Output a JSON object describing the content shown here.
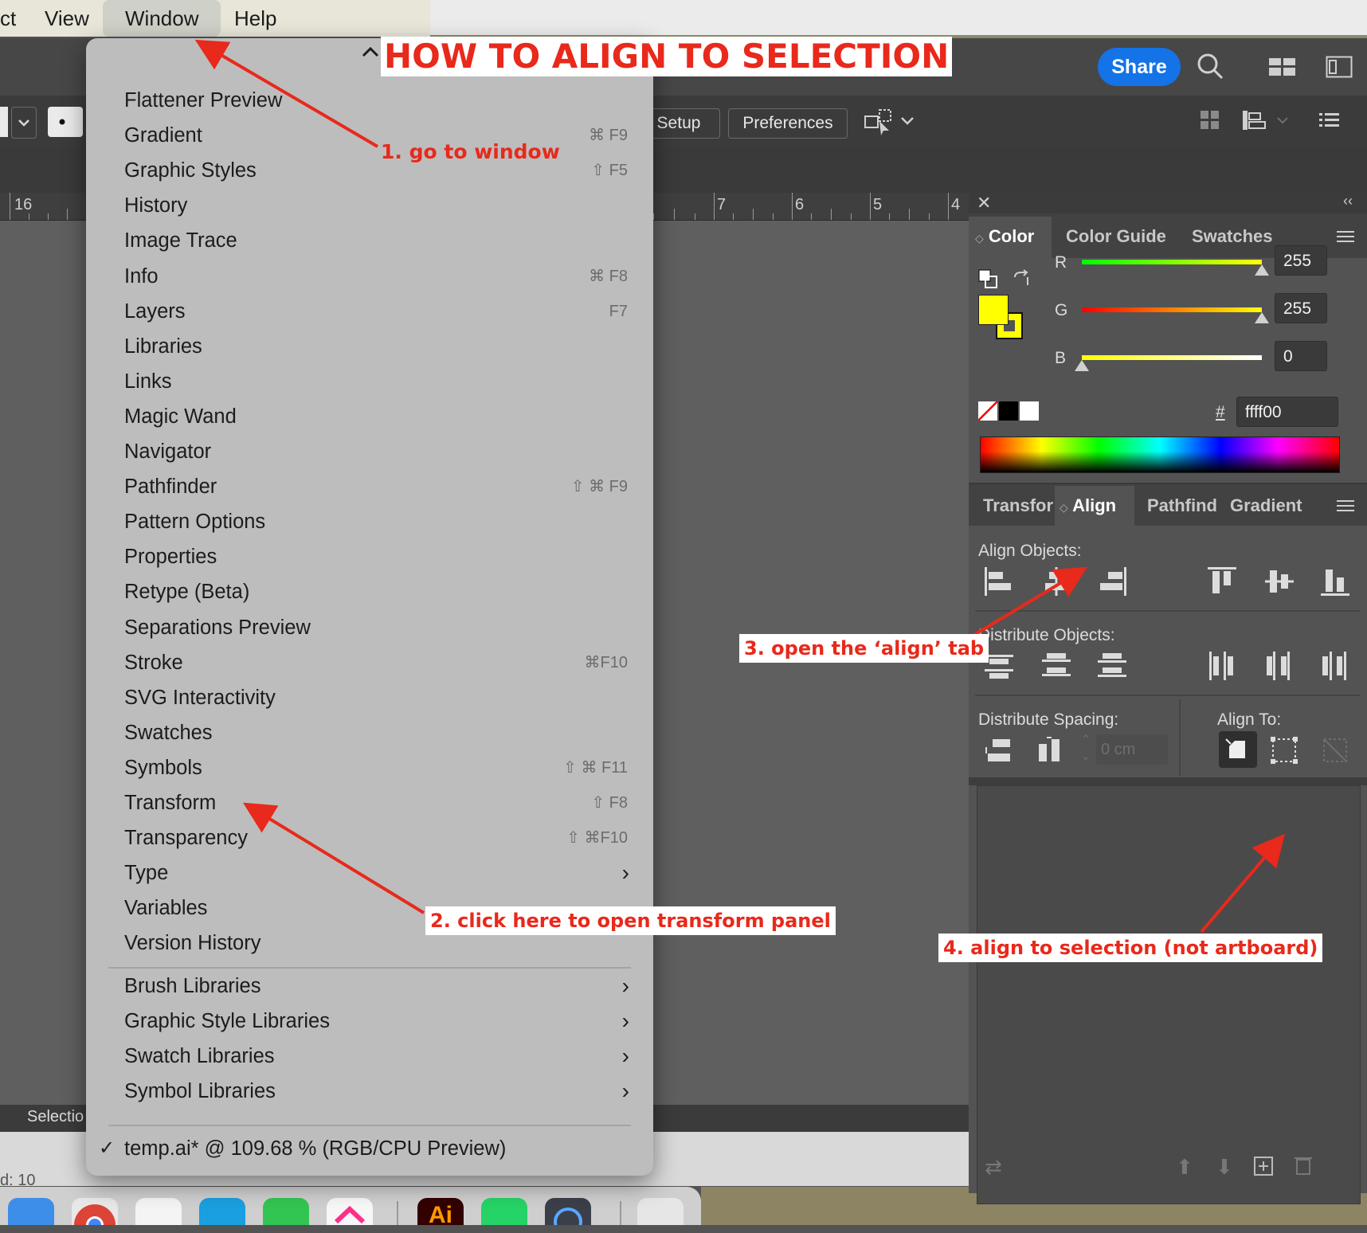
{
  "menubar": {
    "partial_item": "ct",
    "view": "View",
    "window": "Window",
    "help": "Help"
  },
  "header": {
    "share_label": "Share"
  },
  "controlbar": {
    "setup_label": "Setup",
    "preferences_label": "Preferences"
  },
  "ruler": [
    "16",
    "7",
    "6",
    "5",
    "4"
  ],
  "window_menu": {
    "items": [
      {
        "label": "Flattener Preview",
        "shortcut": ""
      },
      {
        "label": "Gradient",
        "shortcut": "⌘ F9"
      },
      {
        "label": "Graphic Styles",
        "shortcut": "⇧ F5"
      },
      {
        "label": "History",
        "shortcut": ""
      },
      {
        "label": "Image Trace",
        "shortcut": ""
      },
      {
        "label": "Info",
        "shortcut": "⌘ F8"
      },
      {
        "label": "Layers",
        "shortcut": "F7"
      },
      {
        "label": "Libraries",
        "shortcut": ""
      },
      {
        "label": "Links",
        "shortcut": ""
      },
      {
        "label": "Magic Wand",
        "shortcut": ""
      },
      {
        "label": "Navigator",
        "shortcut": ""
      },
      {
        "label": "Pathfinder",
        "shortcut": "⇧ ⌘ F9"
      },
      {
        "label": "Pattern Options",
        "shortcut": ""
      },
      {
        "label": "Properties",
        "shortcut": ""
      },
      {
        "label": "Retype (Beta)",
        "shortcut": ""
      },
      {
        "label": "Separations Preview",
        "shortcut": ""
      },
      {
        "label": "Stroke",
        "shortcut": "⌘F10"
      },
      {
        "label": "SVG Interactivity",
        "shortcut": ""
      },
      {
        "label": "Swatches",
        "shortcut": ""
      },
      {
        "label": "Symbols",
        "shortcut": "⇧ ⌘ F11"
      },
      {
        "label": "Transform",
        "shortcut": "⇧ F8"
      },
      {
        "label": "Transparency",
        "shortcut": "⇧ ⌘F10"
      },
      {
        "label": "Type",
        "shortcut": "›"
      },
      {
        "label": "Variables",
        "shortcut": ""
      },
      {
        "label": "Version History",
        "shortcut": ""
      }
    ],
    "libraries": [
      {
        "label": "Brush Libraries",
        "shortcut": "›"
      },
      {
        "label": "Graphic Style Libraries",
        "shortcut": "›"
      },
      {
        "label": "Swatch Libraries",
        "shortcut": "›"
      },
      {
        "label": "Symbol Libraries",
        "shortcut": "›"
      }
    ],
    "document": "temp.ai* @ 109.68 % (RGB/CPU Preview)",
    "checkmark": "✓"
  },
  "color_panel": {
    "tabs": [
      "Color",
      "Color Guide",
      "Swatches"
    ],
    "active_tab": "Color",
    "r_label": "R",
    "r_value": "255",
    "g_label": "G",
    "g_value": "255",
    "b_label": "B",
    "b_value": "0",
    "hash_label": "#",
    "hex_value": "ffff00",
    "fill_color": "#ffff00"
  },
  "align_panel": {
    "tabs": [
      "Transfor",
      "Align",
      "Pathfind",
      "Gradient"
    ],
    "active_tab": "Align",
    "align_objects": "Align Objects:",
    "distribute_objects": "Distribute Objects:",
    "distribute_spacing": "Distribute Spacing:",
    "align_to": "Align To:",
    "spacing_value": "0 cm"
  },
  "status": {
    "tool": "Selectio",
    "bottom_text": "d: 10"
  },
  "annotations": {
    "title": "HOW TO ALIGN TO SELECTION",
    "step1": "1. go to window",
    "step2": "2. click here to open transform panel",
    "step3": "3. open the ‘align’  tab",
    "step4": "4. align to selection (not artboard)",
    "color": "#e8291b"
  },
  "dock": {
    "ai_label": "Ai"
  }
}
